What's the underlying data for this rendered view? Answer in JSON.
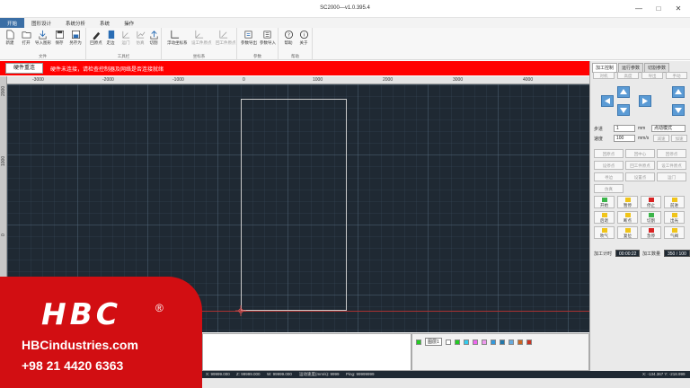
{
  "window": {
    "title": "SC2000—v1.0.395.4",
    "controls": [
      "—",
      "□",
      "✕"
    ]
  },
  "menu_tabs": [
    "开始",
    "图形设计",
    "系统分析",
    "系统",
    "操作"
  ],
  "ribbon": {
    "groups": [
      {
        "label": "文件",
        "buttons": [
          "新建",
          "打开",
          "导入图形",
          "保存",
          "另存为"
        ]
      },
      {
        "label": "工具栏",
        "buttons": [
          "回原点",
          "走边",
          "运门",
          "仿真",
          "切割"
        ]
      },
      {
        "label": "坐标系",
        "buttons": [
          "浮动坐标系",
          "设工件原点",
          "回工件原点"
        ]
      },
      {
        "label": "参数",
        "buttons": [
          "参数导出",
          "参数导入"
        ]
      },
      {
        "label": "帮助",
        "buttons": [
          "帮助",
          "关于"
        ]
      }
    ]
  },
  "status": {
    "hardware_button": "硬件重连",
    "message": "硬件未连接，请检查控制器及网络是否连接就绪"
  },
  "ruler": {
    "h_ticks": [
      "-3000",
      "-2000",
      "-1000",
      "0",
      "1000",
      "2000",
      "3000",
      "4000"
    ],
    "v_ticks": [
      "2000",
      "1000",
      "0"
    ]
  },
  "layers": {
    "label": "图层1",
    "colors": [
      "#22cc22",
      "#ffffff",
      "#22cc22",
      "#33ccee",
      "#ee66ee",
      "#ee99ee",
      "#3399dd",
      "#2277aa",
      "#66aadd",
      "#cc6622",
      "#cc3322"
    ]
  },
  "coords": {
    "x": "X: 99999.000",
    "z": "Z: 99999.000",
    "w": "W: 99999.000",
    "speed": "运动速度(mm/s): 9999",
    "ping": "Ping: 99999999",
    "right": "X: -134.367 Y: -218.999"
  },
  "right_panel": {
    "tabs": [
      "加工控制",
      "运行参数",
      "切割参数"
    ],
    "top_buttons": [
      "对机",
      "高度",
      "导出",
      "手动"
    ],
    "step_label": "步进",
    "step_value": "1",
    "step_unit": "mm",
    "step_mode": "点动模式",
    "speed_label": "速度",
    "speed_value": "100",
    "speed_unit": "mm/s",
    "speed_buttons": [
      "减速",
      "加速"
    ],
    "grid_buttons": [
      "回原点",
      "回中心",
      "回停点",
      "设停点",
      "回工件原点",
      "设工件原点",
      "寻边",
      "设置点",
      "运门",
      "仿真"
    ],
    "control_buttons": [
      "开始",
      "暂停",
      "停止",
      "前进",
      "后退",
      "断点",
      "切割",
      "出光",
      "吹气",
      "复位",
      "急停",
      "气阀"
    ],
    "time_label": "加工计时",
    "time_value": "00:00:22",
    "count_label": "加工数量",
    "count_value": "350 / 100"
  },
  "brand": {
    "logo": "HBC",
    "registered": "®",
    "website": "HBCindustries.com",
    "phone": "+98 21 4420 6363"
  },
  "colors": {
    "accent": "#3a6ea5",
    "alert": "#ff0000",
    "canvas": "#1f2933",
    "brand_red": "#d20e12",
    "arrow_blue": "#5b9bd5"
  }
}
